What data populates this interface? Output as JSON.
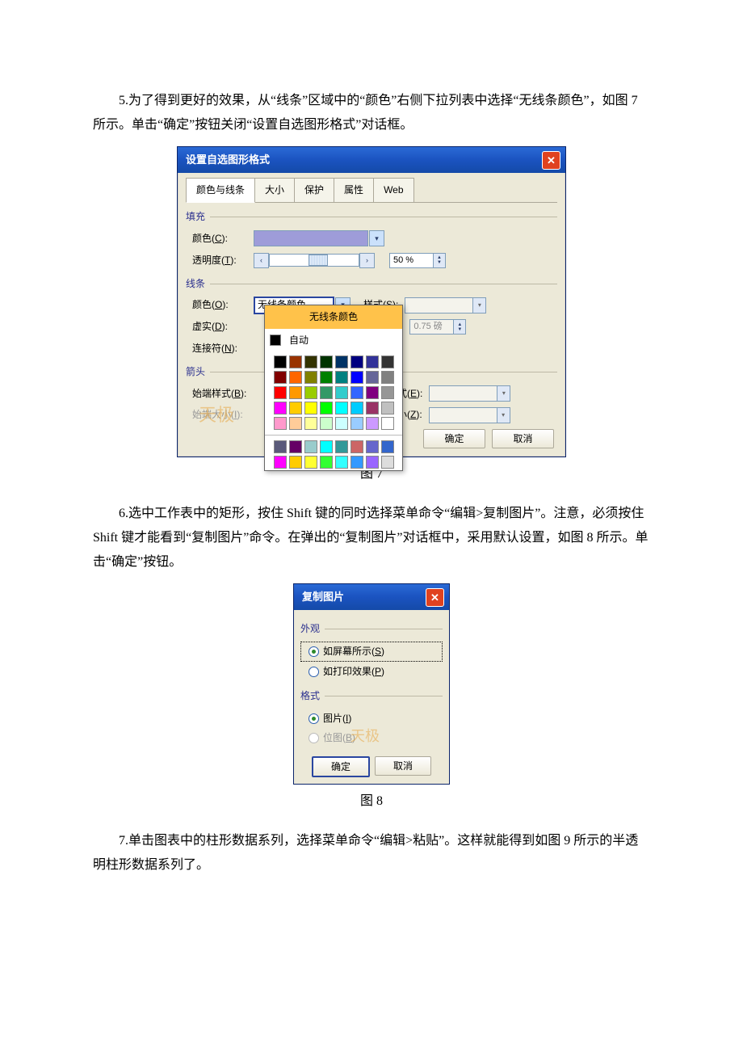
{
  "paragraphs": {
    "p5": "5.为了得到更好的效果，从“线条”区域中的“颜色”右侧下拉列表中选择“无线条颜色”，如图 7 所示。单击“确定”按钮关闭“设置自选图形格式”对话框。",
    "caption7": "图 7",
    "p6": "6.选中工作表中的矩形，按住 Shift 键的同时选择菜单命令“编辑>复制图片”。注意，必须按住 Shift 键才能看到“复制图片”命令。在弹出的“复制图片”对话框中，采用默认设置，如图 8 所示。单击“确定”按钮。",
    "caption8": "图 8",
    "p7": "7.单击图表中的柱形数据系列，选择菜单命令“编辑>粘贴”。这样就能得到如图 9 所示的半透明柱形数据系列了。"
  },
  "fig7": {
    "title": "设置自选图形格式",
    "tabs": [
      "颜色与线条",
      "大小",
      "保护",
      "属性",
      "Web"
    ],
    "groups": {
      "fill": "填充",
      "line": "线条",
      "arrow": "箭头"
    },
    "labels": {
      "fill_color": "颜色(C):",
      "fill_color_key": "C",
      "transparency": "透明度(T):",
      "transparency_key": "T",
      "line_color": "颜色(O):",
      "line_color_key": "O",
      "style": "样式(S):",
      "style_key": "S",
      "dash": "虚实(D):",
      "dash_key": "D",
      "weight_suffix": "):",
      "connector": "连接符(N):",
      "connector_key": "N",
      "begin_style": "始端样式(B):",
      "begin_style_key": "B",
      "end_style_label": "式(E):",
      "end_style_key": "E",
      "begin_size": "始端大小(I):",
      "begin_size_key": "I",
      "end_size_label": "小(Z):",
      "end_size_key": "Z"
    },
    "values": {
      "transparency": "50 %",
      "line_color": "无线条颜色",
      "weight": "0.75 磅"
    },
    "popup": {
      "no_line": "无线条颜色",
      "auto": "自动",
      "colors_row1": [
        "#000000",
        "#993300",
        "#333300",
        "#003300",
        "#003366",
        "#000080",
        "#333399",
        "#333333"
      ],
      "colors_row2": [
        "#800000",
        "#ff6600",
        "#808000",
        "#008000",
        "#008080",
        "#0000ff",
        "#666699",
        "#808080"
      ],
      "colors_row3": [
        "#ff0000",
        "#ff9900",
        "#99cc00",
        "#339966",
        "#33cccc",
        "#3366ff",
        "#800080",
        "#969696"
      ],
      "colors_row4": [
        "#ff00ff",
        "#ffcc00",
        "#ffff00",
        "#00ff00",
        "#00ffff",
        "#00ccff",
        "#993366",
        "#c0c0c0"
      ],
      "colors_row5": [
        "#ff99cc",
        "#ffcc99",
        "#ffff99",
        "#ccffcc",
        "#ccffff",
        "#99ccff",
        "#cc99ff",
        "#ffffff"
      ],
      "extra_row1": [
        "#5a5a7a",
        "#660066",
        "#99cccc",
        "#00ffff",
        "#339999",
        "#cc6666",
        "#6666cc",
        "#3366cc"
      ],
      "extra_row2": [
        "#ff00ff",
        "#ffcc00",
        "#ffff33",
        "#33ff33",
        "#33ffff",
        "#3399ff",
        "#9966ff",
        "#dddddd"
      ]
    },
    "buttons": {
      "ok": "确定",
      "cancel": "取消"
    }
  },
  "fig8": {
    "title": "复制图片",
    "groups": {
      "appearance": "外观",
      "format": "格式"
    },
    "options": {
      "as_screen_base": "如屏幕所示(",
      "as_screen_key": "S",
      "as_print_base": "如打印效果(",
      "as_print_key": "P",
      "picture_base": "图片(",
      "picture_key": "I",
      "bitmap_base": "位图(",
      "bitmap_key": "B",
      "paren_close": ")"
    },
    "buttons": {
      "ok": "确定",
      "cancel": "取消"
    }
  }
}
